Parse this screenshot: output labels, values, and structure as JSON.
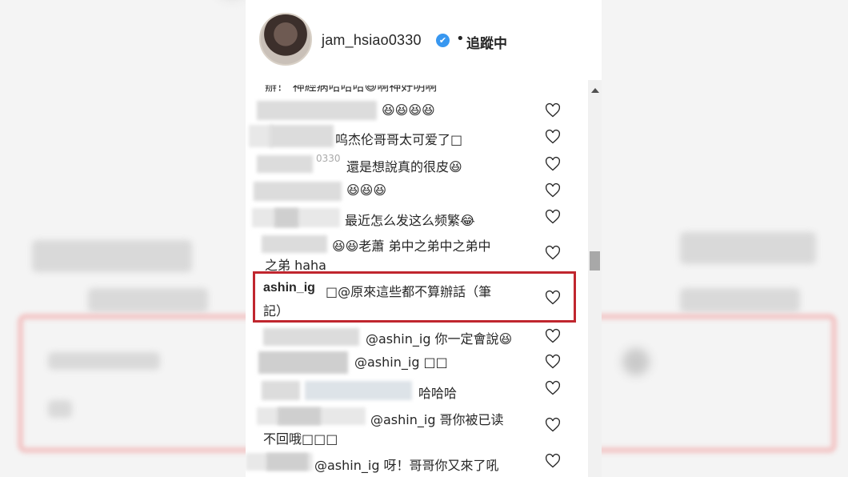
{
  "header": {
    "username": "jam_hsiao0330",
    "verified_icon": "✔",
    "separator": "•",
    "follow_status": "追蹤中"
  },
  "comments": {
    "cut_top": "辦！ 神經病哈哈哈😆啊神好明啊",
    "c1": "😆😆😆😆",
    "c2": "呜杰伦哥哥太可爱了□",
    "c3_prefix": "0330",
    "c3": "還是想說真的很皮😆",
    "c4": "😆😆😆",
    "c5": "最近怎么发这么频繁😂",
    "c6_line1": "😆😆老蕭 弟中之弟中之弟中",
    "c6_line2": "之弟 haha",
    "highlighted_author": "ashin_ig",
    "highlighted_line1": "□@原來這些都不算辦話（筆",
    "highlighted_line2": "記）",
    "c8": "@ashin_ig 你一定會說😆",
    "c9": "@ashin_ig □□",
    "c10": "哈哈哈",
    "c11_line1": "@ashin_ig 哥你被已读",
    "c11_line2": "不回哦□□□",
    "c12": "@ashin_ig 呀！哥哥你又來了吼"
  },
  "colors": {
    "highlight_border": "#c0262e",
    "verified_badge": "#3897f0"
  }
}
